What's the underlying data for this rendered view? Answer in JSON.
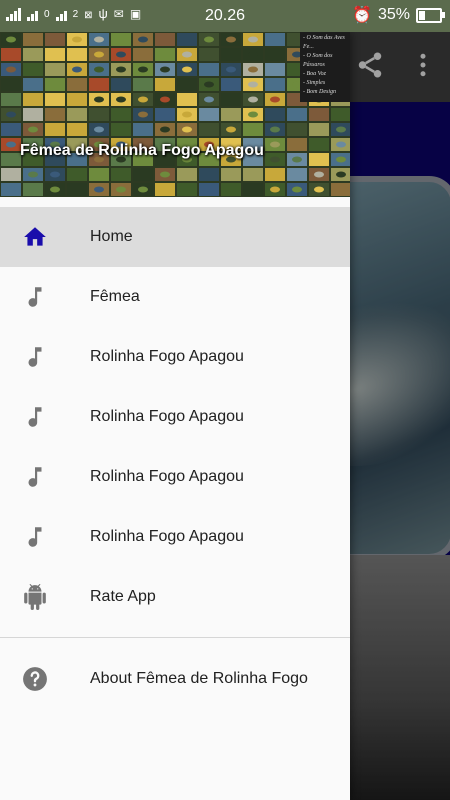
{
  "status_bar": {
    "time": "20.26",
    "battery": "35%",
    "battery_level": 0.35,
    "sim_label": "0",
    "sim2_label": "2"
  },
  "drawer": {
    "header_title": "Fêmea de Rolinha Fogo Apagou",
    "header_caption": [
      "- O Som das Aves Fe...",
      "- O Som dos Pássaros",
      "- Boa Voz",
      "- Simples",
      "- Bom Design"
    ],
    "items": [
      {
        "label": "Home",
        "icon": "home-icon",
        "active": true
      },
      {
        "label": "Fêmea",
        "icon": "music-note-icon"
      },
      {
        "label": "Rolinha Fogo Apagou",
        "icon": "music-note-icon"
      },
      {
        "label": "Rolinha Fogo Apagou",
        "icon": "music-note-icon"
      },
      {
        "label": "Rolinha Fogo Apagou",
        "icon": "music-note-icon"
      },
      {
        "label": "Rolinha Fogo Apagou",
        "icon": "music-note-icon"
      },
      {
        "label": "Rate App",
        "icon": "android-icon"
      }
    ],
    "about": {
      "label": "About Fêmea de Rolinha Fogo",
      "icon": "help-circle-icon"
    }
  },
  "toolbar": {
    "share_icon": "share-icon",
    "more_icon": "more-vert-icon"
  },
  "colors": {
    "active_icon": "#1a0dab",
    "inactive_icon": "#757575",
    "content_bg": "#0b0460"
  }
}
